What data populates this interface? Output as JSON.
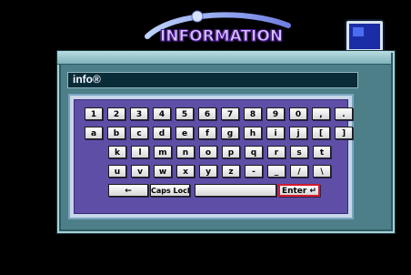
{
  "header": {
    "title": "INFORMATION",
    "icon_left": "orbit-logo-icon",
    "icon_right": "monitor-icon"
  },
  "input": {
    "value": "info®"
  },
  "keyboard": {
    "rows": [
      [
        "1",
        "2",
        "3",
        "4",
        "5",
        "6",
        "7",
        "8",
        "9",
        "0",
        ",",
        "."
      ],
      [
        "a",
        "b",
        "c",
        "d",
        "e",
        "f",
        "g",
        "h",
        "i",
        "j",
        "[",
        "]"
      ],
      [
        "k",
        "l",
        "m",
        "n",
        "o",
        "p",
        "q",
        "r",
        "s",
        "t"
      ],
      [
        "u",
        "v",
        "w",
        "x",
        "y",
        "z",
        "-",
        "_",
        "/",
        "\\"
      ]
    ],
    "bottom": {
      "backspace": "←",
      "caps": "Caps Lock",
      "space": "",
      "enter": "Enter ↵"
    }
  },
  "colors": {
    "background": "#000000",
    "frame": "#4d7f89",
    "panel": "#5f4ea6",
    "key_face": "#ffffff",
    "highlight": "#d51a2a"
  }
}
